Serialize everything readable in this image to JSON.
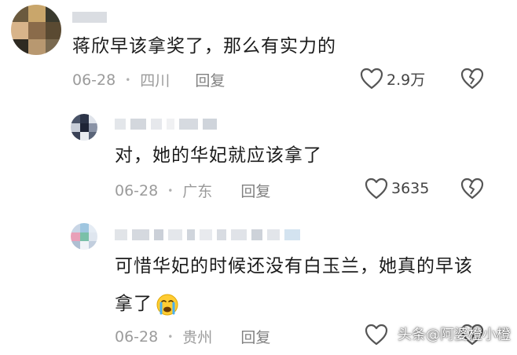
{
  "comments": [
    {
      "text": "蒋欣早该拿奖了，那么有实力的",
      "date": "06-28",
      "location": "四川",
      "reply_label": "回复",
      "like_count": "2.9万"
    },
    {
      "text": "对，她的华妃就应该拿了",
      "date": "06-28",
      "location": "广东",
      "reply_label": "回复",
      "like_count": "3635"
    },
    {
      "text_line1": "可惜华妃的时候还没有白玉兰，她真的早该",
      "text_line2": "拿了",
      "emoji": "crying-face-emoji",
      "date": "06-28",
      "location": "贵州",
      "reply_label": "回复",
      "like_count": ""
    }
  ],
  "icons": {
    "like": "heart-outline-icon",
    "dislike": "broken-heart-icon"
  },
  "watermark": "头条@阿婆橙小橙",
  "colors": {
    "text": "#1c1c1c",
    "meta": "#9b9b9b",
    "icon_stroke": "#555555",
    "background": "#ffffff"
  }
}
